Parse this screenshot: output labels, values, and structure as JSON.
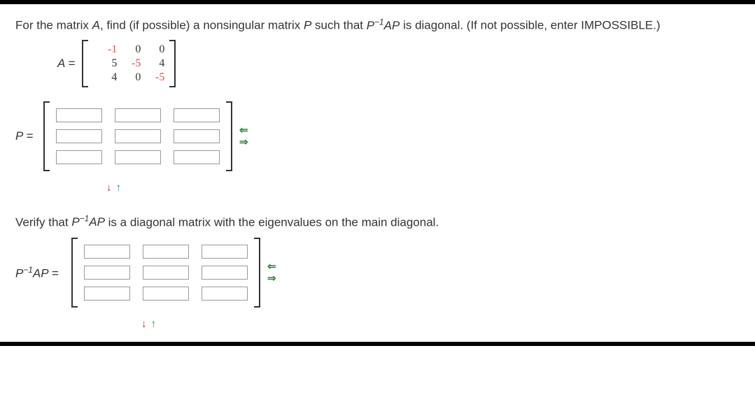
{
  "question": {
    "prompt_part1": "For the matrix ",
    "var_A": "A",
    "prompt_part2": ", find (if possible) a nonsingular matrix ",
    "var_P": "P",
    "prompt_part3": " such that ",
    "expr_html": "P⁻¹AP",
    "prompt_part4": " is diagonal. (If not possible, enter IMPOSSIBLE.)"
  },
  "matrix_A": {
    "label": "A =",
    "rows": [
      [
        "-1",
        "0",
        "0"
      ],
      [
        "5",
        "-5",
        "4"
      ],
      [
        "4",
        "0",
        "-5"
      ]
    ]
  },
  "P_section": {
    "label": "P ="
  },
  "verify": {
    "text_part1": "Verify that ",
    "expr": "P⁻¹AP",
    "text_part2": " is a diagonal matrix with the eigenvalues on the main diagonal."
  },
  "PAP_section": {
    "label": "P⁻¹AP ="
  },
  "input_matrix": {
    "rows": 3,
    "cols": 3,
    "values": [
      [
        "",
        "",
        ""
      ],
      [
        "",
        "",
        ""
      ],
      [
        "",
        "",
        ""
      ]
    ]
  },
  "arrows": {
    "left": "⇐",
    "right": "⇒",
    "down": "↓",
    "up": "↑"
  }
}
